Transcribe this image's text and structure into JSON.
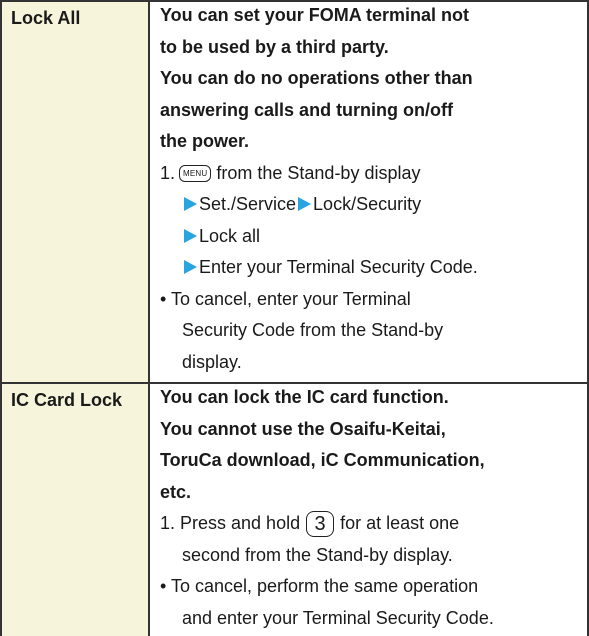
{
  "rows": [
    {
      "label": "Lock All",
      "desc": [
        "You can set your FOMA terminal not",
        "to be used by a third party.",
        "You can do no operations other than",
        "answering calls and turning on/off",
        "the power."
      ],
      "step_num": "1.",
      "menu_key": "MENU",
      "step_text": "from the Stand-by display",
      "path": [
        "Set./Service",
        "Lock/Security",
        "Lock all",
        "Enter your Terminal Security Code."
      ],
      "note": [
        "• To cancel, enter your Terminal",
        "Security Code from the Stand-by",
        "display."
      ]
    },
    {
      "label": "IC Card Lock",
      "desc": [
        "You can lock the IC card function.",
        "You cannot use the Osaifu-Keitai,",
        "ToruCa download, iC Communication,",
        "etc."
      ],
      "step_pre": "1. Press and hold",
      "key": "3",
      "step_post": "for at least one",
      "step_line2": "second from the Stand-by display.",
      "note": [
        "• To cancel, perform the same operation",
        "and enter your Terminal Security Code."
      ]
    }
  ],
  "colors": {
    "label_bg": "#f7f4dc",
    "arrow": "#2aa4e0",
    "border": "#333333"
  }
}
